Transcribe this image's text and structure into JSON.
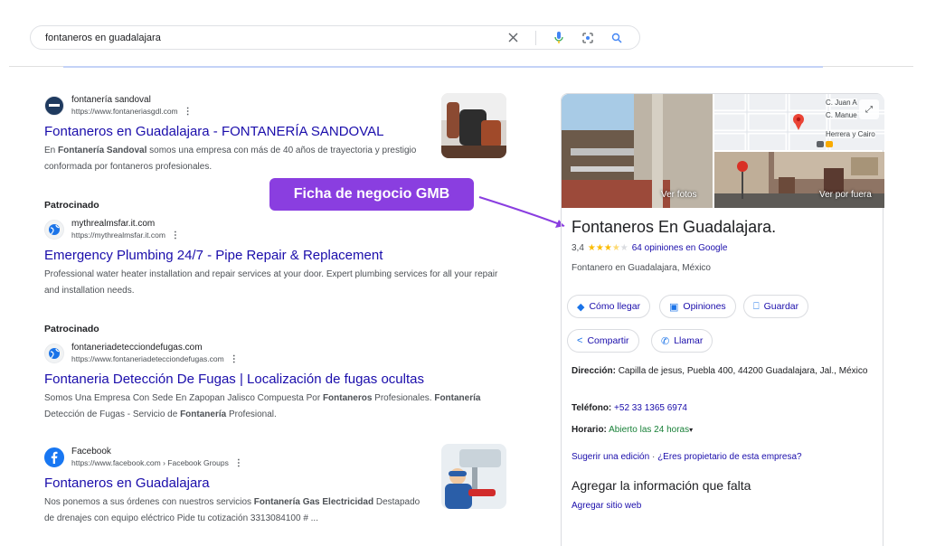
{
  "search": {
    "query": "fontaneros en guadalajara"
  },
  "results": [
    {
      "site_name": "fontanería sandoval",
      "url": "https://www.fontaneriasgdl.com",
      "title": "Fontaneros en Guadalajara - FONTANERÍA SANDOVAL",
      "snippet_parts": [
        "En ",
        "Fontanería Sandoval",
        " somos una empresa con más de 40 años de trayectoria y prestigio conformada por fontaneros profesionales."
      ]
    },
    {
      "sponsored": "Patrocinado",
      "site_name": "mythrealmsfar.it.com",
      "url": "https://mythrealmsfar.it.com",
      "title": "Emergency Plumbing 24/7 - Pipe Repair & Replacement",
      "snippet": "Professional water heater installation and repair services at your door. Expert plumbing services for all your repair and installation needs."
    },
    {
      "sponsored": "Patrocinado",
      "site_name": "fontaneriadetecciondefugas.com",
      "url": "https://www.fontaneriadetecciondefugas.com",
      "title": "Fontaneria Detección De Fugas | Localización de fugas ocultas",
      "snippet_parts": [
        "Somos Una Empresa Con Sede En Zapopan Jalisco Compuesta Por ",
        "Fontaneros",
        " Profesionales. ",
        "Fontanería",
        " Detección de Fugas - Servicio de ",
        "Fontanería",
        " Profesional."
      ]
    },
    {
      "site_name": "Facebook",
      "url": "https://www.facebook.com › Facebook Groups",
      "title": "Fontaneros en Guadalajara",
      "snippet_parts": [
        "Nos ponemos a sus órdenes con nuestros servicios ",
        "Fontanería Gas Electricidad",
        " Destapado de drenajes con equipo eléctrico Pide tu cotización 3313084100 # ..."
      ]
    }
  ],
  "annotation": {
    "label": "Ficha de negocio GMB"
  },
  "panel": {
    "photo_button": "Ver fotos",
    "outside_button": "Ver por fuera",
    "map_labels": [
      "C. Juan A",
      "C. Manue",
      "Herrera y Cairo"
    ],
    "name": "Fontaneros En Guadalajara.",
    "rating": "3,4",
    "rating_value": 3.4,
    "reviews": "64 opiniones en Google",
    "category": "Fontanero en Guadalajara, México",
    "buttons": {
      "directions": "Cómo llegar",
      "reviews": "Opiniones",
      "save": "Guardar",
      "share": "Compartir",
      "call": "Llamar"
    },
    "address_label": "Dirección:",
    "address": "Capilla de jesus, Puebla 400, 44200 Guadalajara, Jal., México",
    "phone_label": "Teléfono:",
    "phone": "+52 33 1365 6974",
    "hours_label": "Horario:",
    "hours": "Abierto las 24 horas",
    "suggest_edit": "Sugerir una edición",
    "owner_question": "¿Eres propietario de esta empresa?",
    "separator": "·",
    "missing_heading": "Agregar la información que falta",
    "add_website": "Agregar sitio web"
  },
  "colors": {
    "link": "#1a0dab",
    "accent": "#1a73e8",
    "annotation": "#8a3ee0",
    "open": "#188038",
    "star": "#fbbc04"
  }
}
